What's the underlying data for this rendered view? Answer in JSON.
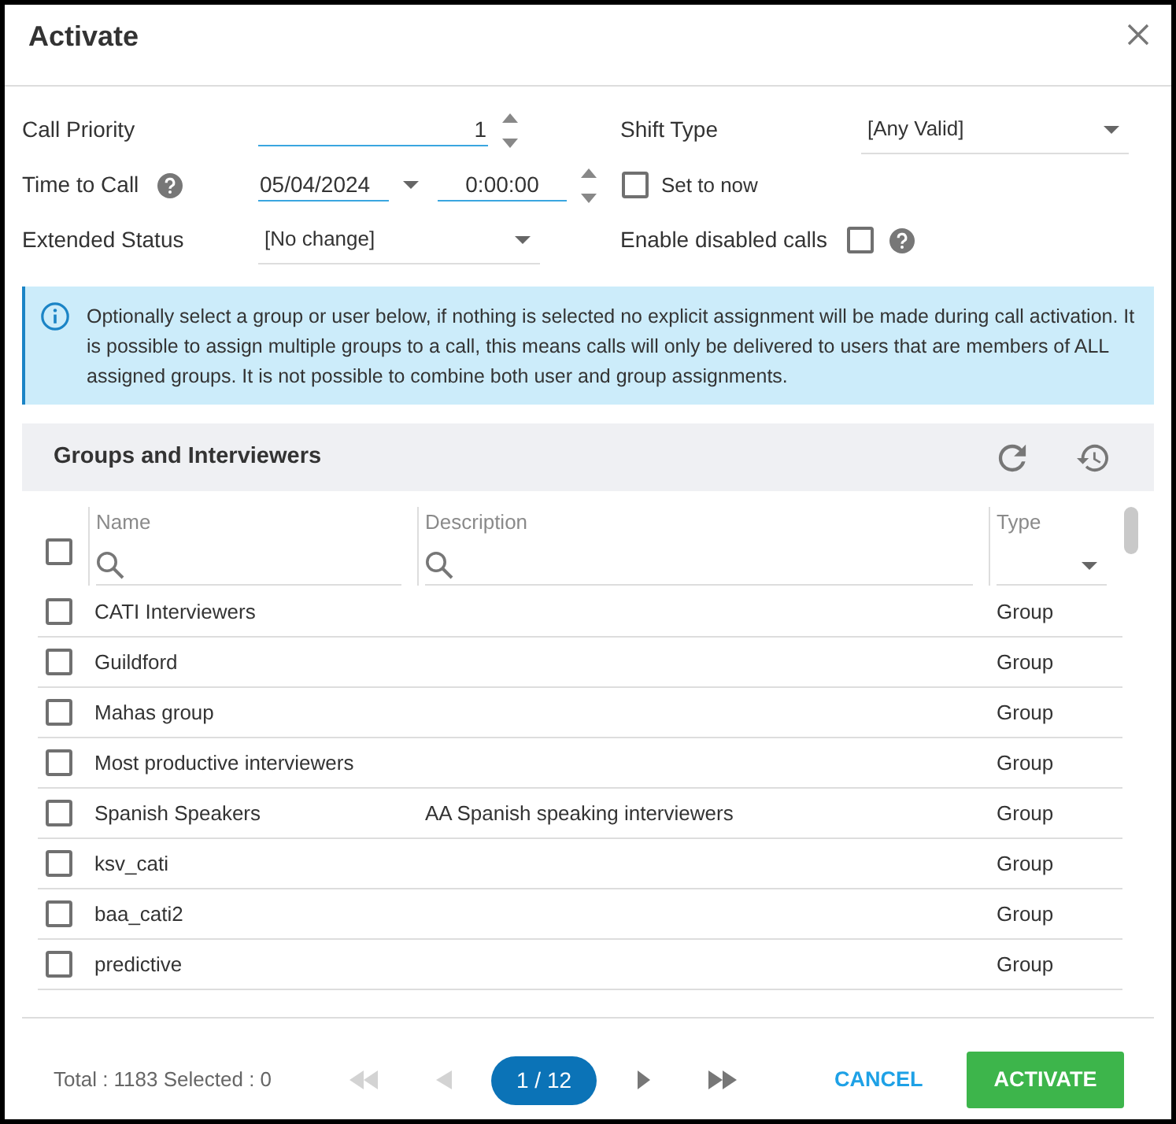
{
  "window": {
    "title": "Activate"
  },
  "form": {
    "call_priority": {
      "label": "Call Priority",
      "value": "1"
    },
    "shift_type": {
      "label": "Shift Type",
      "value": "[Any Valid]"
    },
    "time_to_call": {
      "label": "Time to Call",
      "date": "05/04/2024",
      "time": "0:00:00"
    },
    "set_to_now": {
      "label": "Set to now",
      "checked": false
    },
    "extended_status": {
      "label": "Extended Status",
      "value": "[No change]"
    },
    "enable_disabled_calls": {
      "label": "Enable disabled calls",
      "checked": false
    }
  },
  "info": {
    "text": "Optionally select a group or user below, if nothing is selected no explicit assignment will be made during call activation. It is possible to assign multiple groups to a call, this means calls will only be delivered to users that are members of ALL assigned groups. It is not possible to combine both user and group assignments."
  },
  "groups": {
    "title": "Groups and Interviewers",
    "select_all": {
      "checked": false
    },
    "columns": [
      {
        "label": "Name",
        "kind": "search"
      },
      {
        "label": "Description",
        "kind": "search"
      },
      {
        "label": "Type",
        "kind": "dropdown"
      }
    ],
    "rows": [
      {
        "name": "CATI Interviewers",
        "type": "Group",
        "checked": false
      },
      {
        "name": "Guildford",
        "type": "Group",
        "checked": false
      },
      {
        "name": "Mahas group",
        "type": "Group",
        "checked": false
      },
      {
        "name": "Most productive interviewers",
        "type": "Group",
        "checked": false
      },
      {
        "name": "Spanish Speakers",
        "description": "AA Spanish speaking interviewers",
        "type": "Group",
        "checked": false
      },
      {
        "name": "ksv_cati",
        "type": "Group",
        "checked": false
      },
      {
        "name": "baa_cati2",
        "type": "Group",
        "checked": false
      },
      {
        "name": "predictive",
        "type": "Group",
        "checked": false
      }
    ]
  },
  "footer": {
    "summary": "Total : 1183 Selected : 0",
    "pager": [
      {
        "kind": "first",
        "disabled": true
      },
      {
        "kind": "previous",
        "disabled": true
      },
      {
        "kind": "page",
        "label": "1 / 12"
      },
      {
        "kind": "next",
        "disabled": false
      },
      {
        "kind": "last",
        "disabled": false
      }
    ],
    "buttons": [
      {
        "kind": "link",
        "label": "CANCEL"
      },
      {
        "kind": "primary",
        "label": "ACTIVATE"
      }
    ]
  }
}
